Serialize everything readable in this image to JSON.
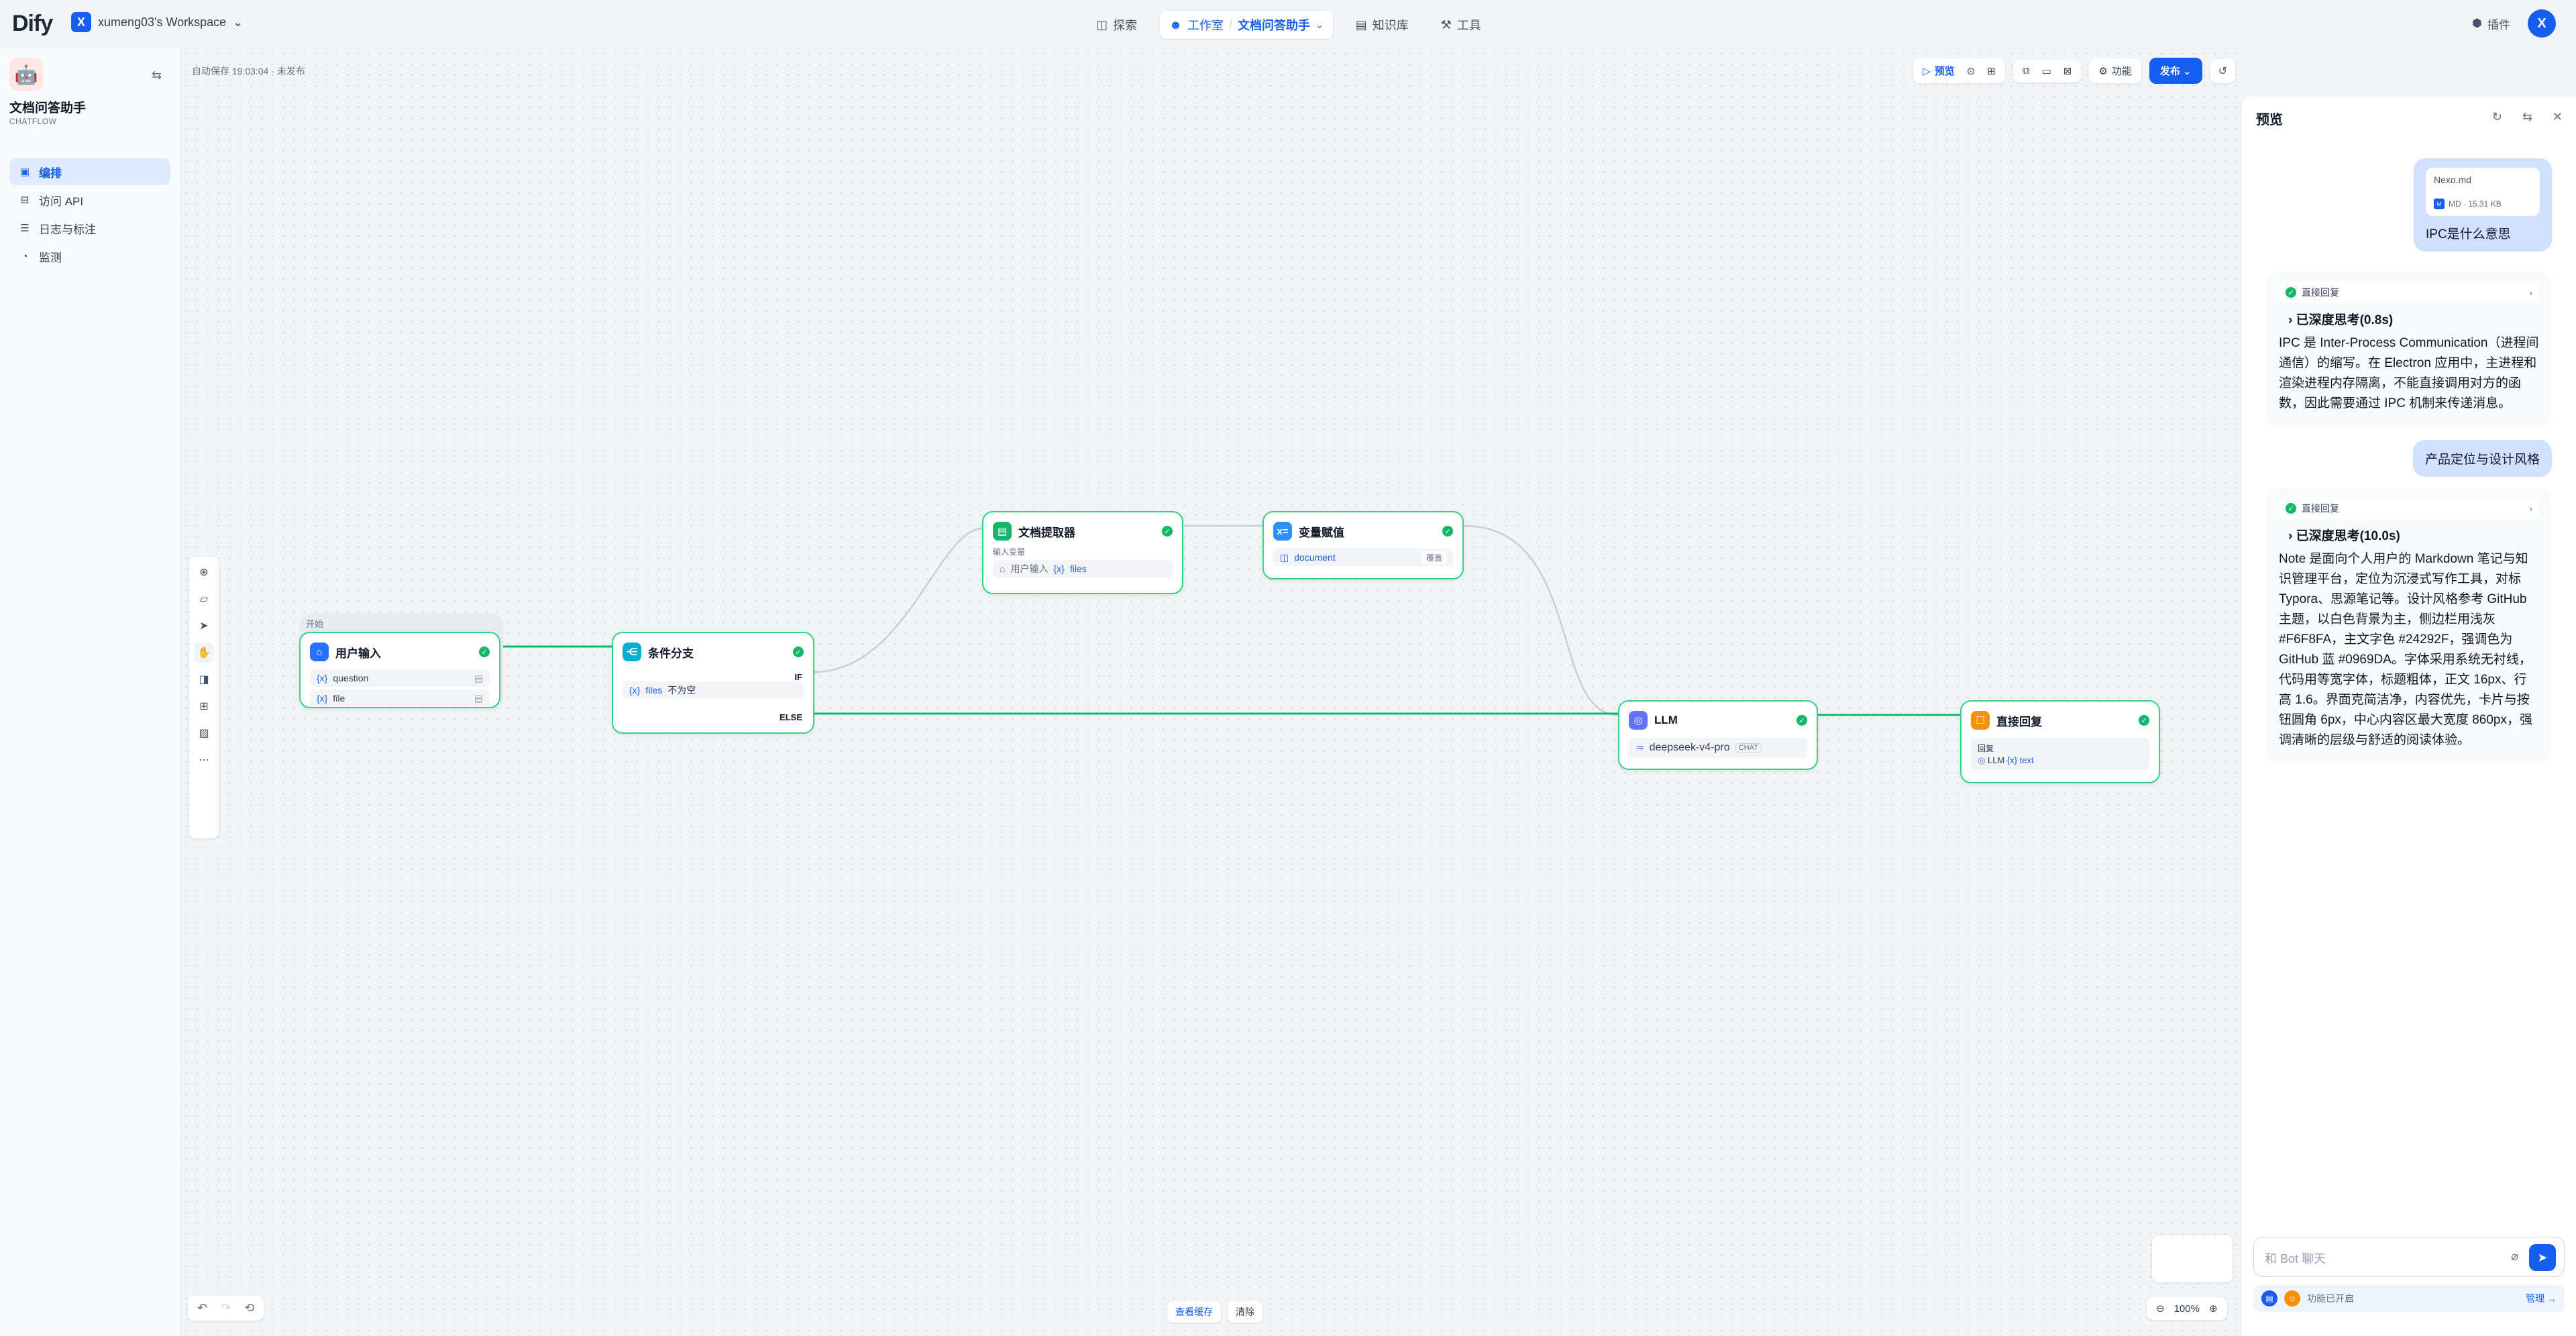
{
  "topbar": {
    "logo": "Dify",
    "workspace_badge": "X",
    "workspace_name": "xumeng03's Workspace",
    "nav": {
      "explore": "探索",
      "studio": "工作室",
      "app_name": "文档问答助手",
      "knowledge": "知识库",
      "tools": "工具"
    },
    "plugins": "插件",
    "avatar": "X"
  },
  "sidebar": {
    "app_title": "文档问答助手",
    "app_type": "CHATFLOW",
    "items": [
      {
        "label": "编排",
        "icon": "orchestrate-icon"
      },
      {
        "label": "访问 API",
        "icon": "api-icon"
      },
      {
        "label": "日志与标注",
        "icon": "logs-icon"
      },
      {
        "label": "监测",
        "icon": "monitor-icon"
      }
    ]
  },
  "canvas": {
    "autosave": "自动保存 19:03:04 · 未发布",
    "toolbar": {
      "preview": "预览",
      "features": "功能",
      "publish": "发布"
    },
    "bottom": {
      "view_cache": "查看缓存",
      "clear": "清除",
      "zoom": "100%"
    }
  },
  "nodes": {
    "start": {
      "group_label": "开始",
      "title": "用户输入",
      "vars": [
        "question",
        "file"
      ]
    },
    "ifelse": {
      "title": "条件分支",
      "if_label": "IF",
      "cond_var": "files",
      "cond_op": "不为空",
      "else_label": "ELSE"
    },
    "doc_extract": {
      "title": "文档提取器",
      "sub": "输入变量",
      "input": "用户输入",
      "var": "files"
    },
    "assigner": {
      "title": "变量赋值",
      "var": "document",
      "op": "覆盖"
    },
    "llm": {
      "title": "LLM",
      "model": "deepseek-v4-pro",
      "mode": "CHAT"
    },
    "answer": {
      "title": "直接回复",
      "sub": "回复",
      "src": "LLM",
      "var": "text"
    }
  },
  "chat": {
    "title": "预览",
    "messages": [
      {
        "role": "user",
        "file_name": "Nexo.md",
        "file_meta": "MD · 15.31 KB",
        "text": "IPC是什么意思"
      },
      {
        "role": "bot",
        "status": "直接回复",
        "thinking": "已深度思考(0.8s)",
        "text": "IPC 是 Inter-Process Communication（进程间通信）的缩写。在 Electron 应用中，主进程和渲染进程内存隔离，不能直接调用对方的函数，因此需要通过 IPC 机制来传递消息。"
      },
      {
        "role": "user",
        "text": "产品定位与设计风格"
      },
      {
        "role": "bot",
        "status": "直接回复",
        "thinking": "已深度思考(10.0s)",
        "text": "Note 是面向个人用户的 Markdown 笔记与知识管理平台，定位为沉浸式写作工具，对标 Typora、思源笔记等。设计风格参考 GitHub 主题，以白色背景为主，侧边栏用浅灰 #F6F8FA，主文字色 #24292F，强调色为 GitHub 蓝 #0969DA。字体采用系统无衬线，代码用等宽字体，标题粗体，正文 16px、行高 1.6。界面克简洁净，内容优先，卡片与按钮圆角 6px，中心内容区最大宽度 860px，强调清晰的层级与舒适的阅读体验。"
      }
    ],
    "input_placeholder": "和 Bot 聊天",
    "features_enabled": "功能已开启",
    "manage": "管理 →"
  }
}
